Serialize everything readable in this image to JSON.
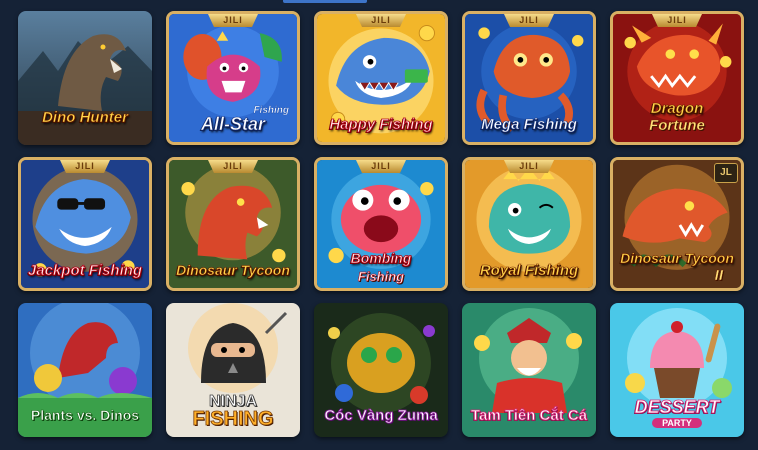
{
  "brand_tab": "JILI",
  "corner_badge": "JL",
  "games": [
    {
      "title": "Dino Hunter"
    },
    {
      "title": "All-Star",
      "subtitle": "Fishing"
    },
    {
      "title": "Happy Fishing"
    },
    {
      "title": "Mega Fishing"
    },
    {
      "title": "Dragon",
      "subtitle": "Fortune"
    },
    {
      "title": "Jackpot Fishing"
    },
    {
      "title": "Dinosaur Tycoon"
    },
    {
      "title": "Bombing",
      "subtitle": "Fishing"
    },
    {
      "title": "Royal Fishing"
    },
    {
      "title": "Dinosaur Tycoon",
      "subtitle": "II"
    },
    {
      "title": "Plants vs. Dinos"
    },
    {
      "title": "NINJA",
      "subtitle": "FISHING"
    },
    {
      "title": "Cóc Vàng Zuma"
    },
    {
      "title": "Tam Tiên Cắt Cá"
    },
    {
      "title": "DESSERT",
      "subtitle": "PARTY"
    }
  ],
  "colors": {
    "page_background": "#152236",
    "tile_frame": "#d9b064",
    "title_gold": "#ffd84a",
    "active_indicator": "#3d74c8"
  }
}
